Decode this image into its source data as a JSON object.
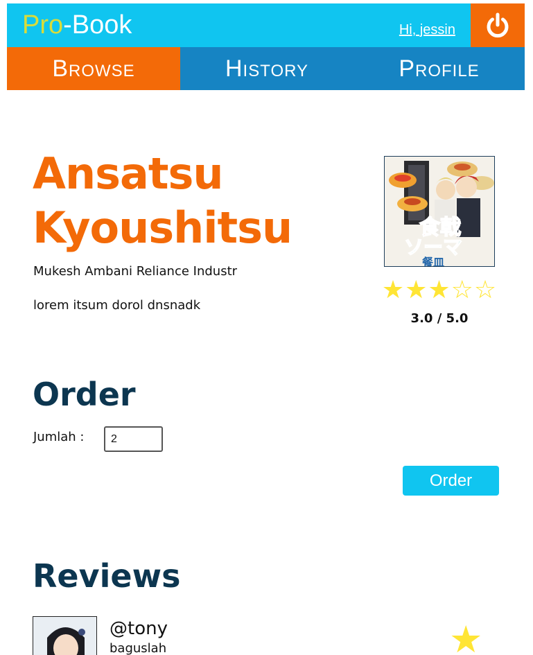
{
  "header": {
    "logo_pro": "Pro",
    "logo_rest": "-Book",
    "greeting": "Hi, jessin",
    "logout_icon": "power-icon"
  },
  "nav": {
    "tabs": [
      {
        "label": "Browse",
        "active": true
      },
      {
        "label": "History",
        "active": false
      },
      {
        "label": "Profile",
        "active": false
      }
    ]
  },
  "book": {
    "title": "Ansatsu Kyoushitsu",
    "author": "Mukesh Ambani Reliance Industr",
    "description": "lorem itsum dorol dnsnadk",
    "cover_icon": "book-cover-image",
    "rating_stars": "★★★☆☆",
    "rating": 3,
    "rating_text": "3.0 / 5.0"
  },
  "order": {
    "heading": "Order",
    "quantity_label": "Jumlah :",
    "quantity_value": "2",
    "button_label": "Order"
  },
  "reviews": {
    "heading": "Reviews",
    "items": [
      {
        "username": "@tony",
        "comment": "baguslah",
        "star": "★"
      }
    ]
  },
  "colors": {
    "header_bg": "#10c5f0",
    "accent_orange": "#f36a08",
    "nav_blue": "#1684c3",
    "logo_pro": "#d9dc3a",
    "heading_navy": "#0c3650",
    "star_yellow": "#ffe535"
  }
}
